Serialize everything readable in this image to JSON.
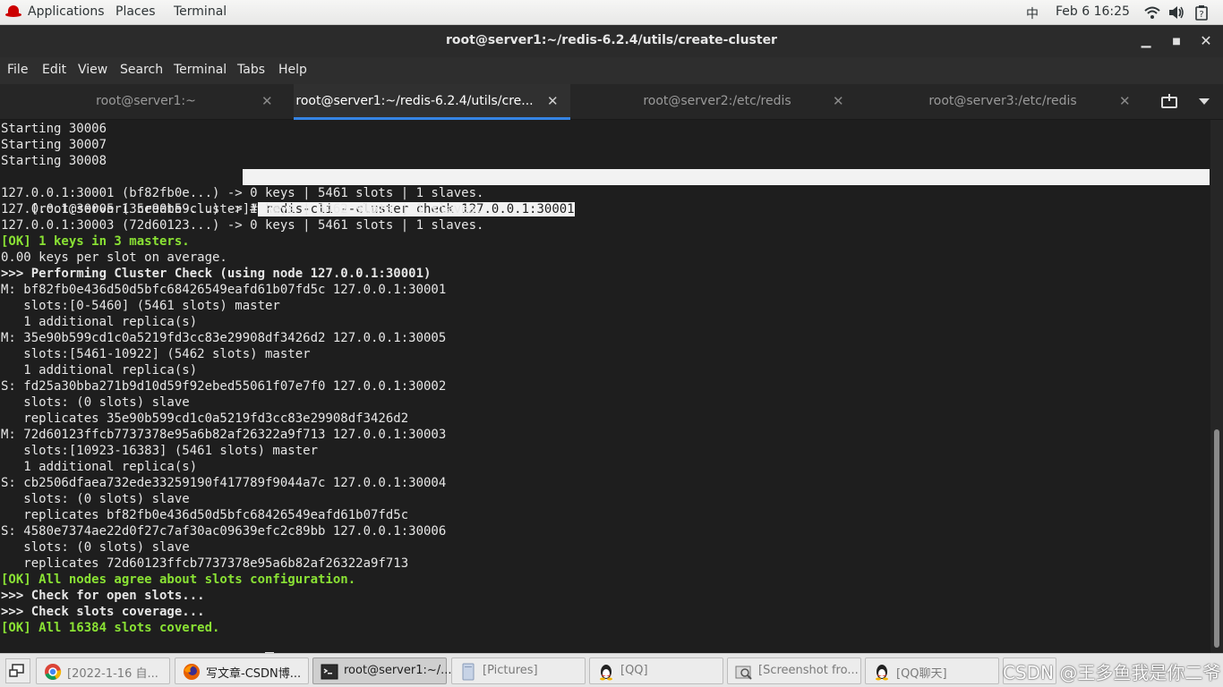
{
  "topbar": {
    "applications": "Applications",
    "places": "Places",
    "terminal": "Terminal",
    "ime": "中",
    "clock": "Feb 6  16:25"
  },
  "window": {
    "title": "root@server1:~/redis-6.2.4/utils/create-cluster"
  },
  "menu": [
    "File",
    "Edit",
    "View",
    "Search",
    "Terminal",
    "Tabs",
    "Help"
  ],
  "tabs": [
    {
      "label": "root@server1:~",
      "active": false
    },
    {
      "label": "root@server1:~/redis-6.2.4/utils/cre...",
      "active": true
    },
    {
      "label": "root@server2:/etc/redis",
      "active": false
    },
    {
      "label": "root@server3:/etc/redis",
      "active": false
    }
  ],
  "terminal": {
    "lines": [
      {
        "text": "Starting 30006",
        "style": "normal"
      },
      {
        "text": "Starting 30007",
        "style": "normal"
      },
      {
        "text": "Starting 30008",
        "style": "normal"
      },
      {
        "text": "",
        "style": "prompt-cmd"
      },
      {
        "text": "127.0.0.1:30001 (bf82fb0e...) -> 0 keys | 5461 slots | 1 slaves.",
        "style": "normal"
      },
      {
        "text": "127.0.0.1:30005 (35e90b59...) -> 1 keys | 5462 slots | 1 slaves.",
        "style": "normal"
      },
      {
        "text": "127.0.0.1:30003 (72d60123...) -> 0 keys | 5461 slots | 1 slaves.",
        "style": "normal"
      },
      {
        "text": "[OK] 1 keys in 3 masters.",
        "style": "ok"
      },
      {
        "text": "0.00 keys per slot on average.",
        "style": "normal"
      },
      {
        "text": ">>> Performing Cluster Check (using node 127.0.0.1:30001)",
        "style": "bold"
      },
      {
        "text": "M: bf82fb0e436d50d5bfc68426549eafd61b07fd5c 127.0.0.1:30001",
        "style": "normal"
      },
      {
        "text": "   slots:[0-5460] (5461 slots) master",
        "style": "normal"
      },
      {
        "text": "   1 additional replica(s)",
        "style": "normal"
      },
      {
        "text": "M: 35e90b599cd1c0a5219fd3cc83e29908df3426d2 127.0.0.1:30005",
        "style": "normal"
      },
      {
        "text": "   slots:[5461-10922] (5462 slots) master",
        "style": "normal"
      },
      {
        "text": "   1 additional replica(s)",
        "style": "normal"
      },
      {
        "text": "S: fd25a30bba271b9d10d59f92ebed55061f07e7f0 127.0.0.1:30002",
        "style": "normal"
      },
      {
        "text": "   slots: (0 slots) slave",
        "style": "normal"
      },
      {
        "text": "   replicates 35e90b599cd1c0a5219fd3cc83e29908df3426d2",
        "style": "normal"
      },
      {
        "text": "M: 72d60123ffcb7737378e95a6b82af26322a9f713 127.0.0.1:30003",
        "style": "normal"
      },
      {
        "text": "   slots:[10923-16383] (5461 slots) master",
        "style": "normal"
      },
      {
        "text": "   1 additional replica(s)",
        "style": "normal"
      },
      {
        "text": "S: cb2506dfaea732ede33259190f417789f9044a7c 127.0.0.1:30004",
        "style": "normal"
      },
      {
        "text": "   slots: (0 slots) slave",
        "style": "normal"
      },
      {
        "text": "   replicates bf82fb0e436d50d5bfc68426549eafd61b07fd5c",
        "style": "normal"
      },
      {
        "text": "S: 4580e7374ae22d0f27c7af30ac09639efc2c89bb 127.0.0.1:30006",
        "style": "normal"
      },
      {
        "text": "   slots: (0 slots) slave",
        "style": "normal"
      },
      {
        "text": "   replicates 72d60123ffcb7737378e95a6b82af26322a9f713",
        "style": "normal"
      },
      {
        "text": "[OK] All nodes agree about slots configuration.",
        "style": "ok"
      },
      {
        "text": ">>> Check for open slots...",
        "style": "bold"
      },
      {
        "text": ">>> Check slots coverage...",
        "style": "bold"
      },
      {
        "text": "[OK] All 16384 slots covered.",
        "style": "ok"
      },
      {
        "text": "",
        "style": "prompt-final"
      }
    ],
    "prompt": "[root@server1 create-cluster]#",
    "command": " redis-cli --cluster check 127.0.0.1:30001"
  },
  "taskbar": {
    "items": [
      {
        "label": "[2022-1-16 自...",
        "icon": "chrome-icon",
        "active": false
      },
      {
        "label": "写文章-CSDN博...",
        "icon": "firefox-icon",
        "active": false
      },
      {
        "label": "root@server1:~/...",
        "icon": "terminal-icon",
        "active": true
      },
      {
        "label": "[Pictures]",
        "icon": "file-manager-icon",
        "active": false
      },
      {
        "label": "[QQ]",
        "icon": "qq-icon",
        "active": false
      },
      {
        "label": "[Screenshot fro...",
        "icon": "screenshot-icon",
        "active": false
      },
      {
        "label": "[QQ聊天]",
        "icon": "qq-icon",
        "active": false
      }
    ],
    "watermark": "CSDN @王多鱼我是你二爷"
  }
}
